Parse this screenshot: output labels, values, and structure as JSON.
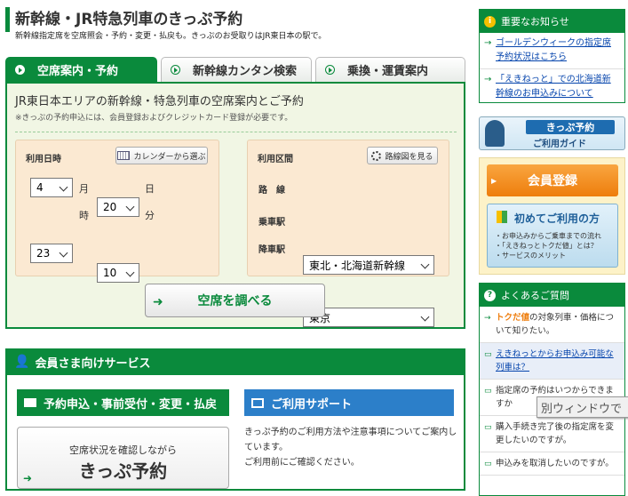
{
  "header": {
    "title": "新幹線・JR特急列車のきっぷ予約",
    "subtitle": "新幹線指定席を空席照会・予約・変更・払戻も。きっぷのお受取りはJR東日本の駅で。"
  },
  "tabs": [
    {
      "label": "空席案内・予約"
    },
    {
      "label": "新幹線カンタン検索"
    },
    {
      "label": "乗換・運賃案内"
    }
  ],
  "panel": {
    "heading": "JR東日本エリアの新幹線・特急列車の空席案内とご予約",
    "note": "※きっぷの予約申込には、会員登録およびクレジットカード登録が必要です。"
  },
  "date": {
    "label": "利用日時",
    "calendar_button": "カレンダーから選ぶ",
    "month": "4",
    "month_unit": "月",
    "day": "20",
    "day_unit": "日",
    "hour": "23",
    "hour_unit": "時",
    "minute": "10",
    "minute_unit": "分"
  },
  "route": {
    "label": "利用区間",
    "map_button": "路線図を見る",
    "line_label": "路　線",
    "line_value": "東北・北海道新幹線",
    "board_label": "乗車駅",
    "board_value": "東京",
    "alight_label": "降車駅",
    "alight_value": "東京"
  },
  "search_button": "空席を調べる",
  "member": {
    "title": "会員さま向けサービス",
    "reserve_button": "予約申込・事前受付・変更・払戻",
    "support_button": "ご利用サポート",
    "reserve_sub": "空席状況を確認しながら",
    "reserve_main": "きっぷ予約",
    "support_text": "きっぷ予約のご利用方法や注意事項についてご案内しています。",
    "support_text2": "ご利用前にご確認ください。"
  },
  "sidebar": {
    "notice_title": "重要なお知らせ",
    "notices": [
      "ゴールデンウィークの指定席予約状況はこちら",
      "「えきねっと」での北海道新幹線のお申込みについて"
    ],
    "guide_title": "きっぷ予約",
    "guide_sub": "ご利用ガイド",
    "register_button": "会員登録",
    "first_title": "初めてご利用の方",
    "first_items": [
      "・お申込みからご乗車までの流れ",
      "・「えきねっとトクだ値」とは？",
      "・サービスのメリット"
    ],
    "faq_title": "よくあるご質問",
    "faq": [
      {
        "pre": "トクだ値",
        "text": "の対象列車・価格について知りたい。",
        "link": false
      },
      {
        "pre": "",
        "text": "えきねっとからお申込み可能な列車は？",
        "link": true
      },
      {
        "pre": "",
        "text": "指定席の予約はいつからできますか",
        "link": false
      },
      {
        "pre": "",
        "text": "購入手続き完了後の指定席を変更したいのですが。",
        "link": false
      },
      {
        "pre": "",
        "text": "申込みを取消したいのですが。",
        "link": false
      }
    ]
  },
  "tooltip": "別ウィンドウで",
  "colors": {
    "green": "#0a8a3c",
    "blue": "#2c7fc9",
    "orange": "#f08c1e"
  }
}
